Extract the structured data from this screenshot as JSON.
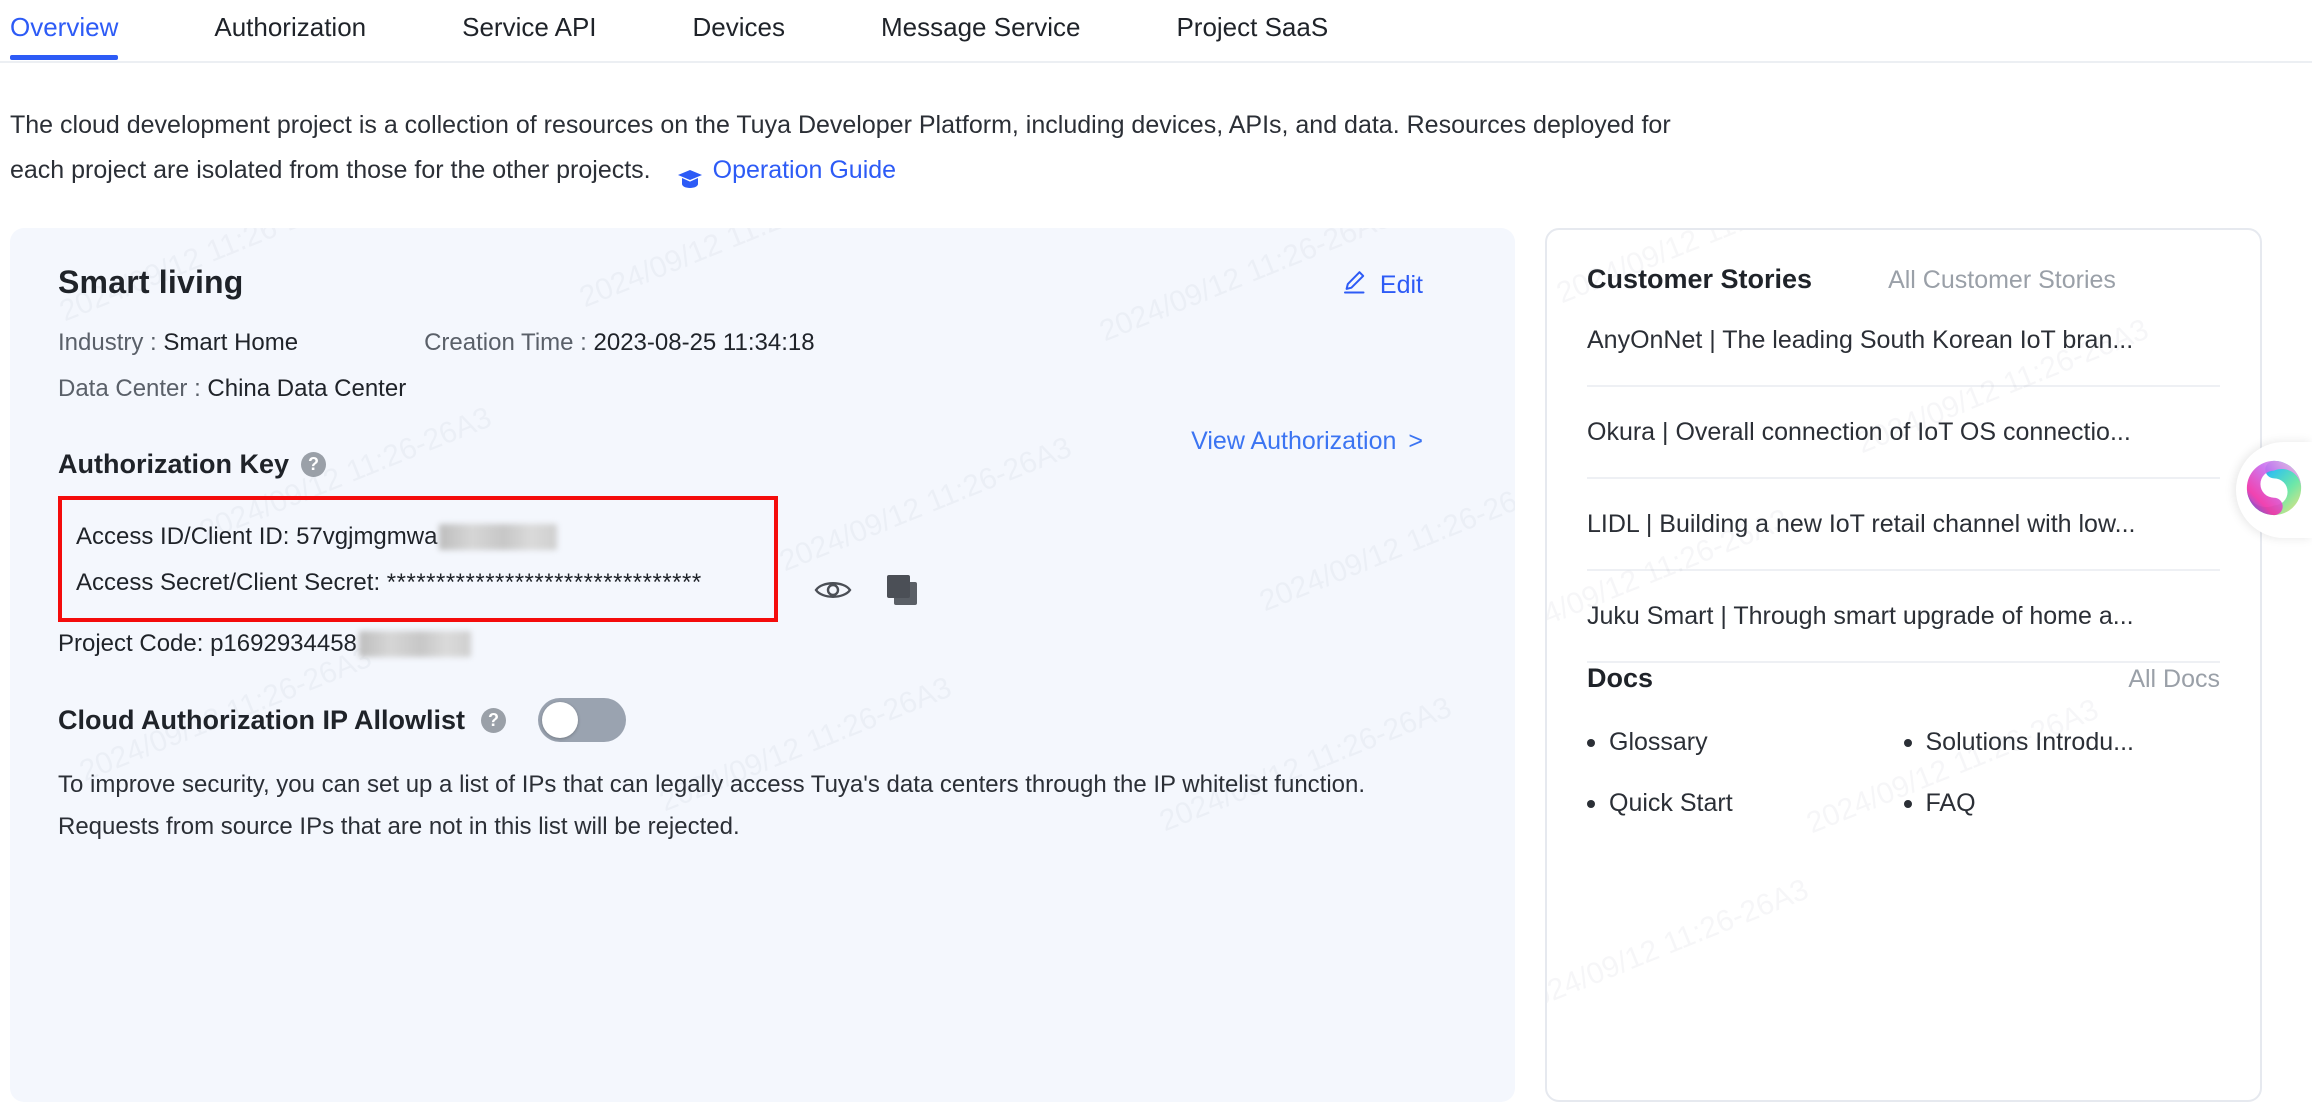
{
  "tabs": [
    {
      "label": "Overview",
      "active": true
    },
    {
      "label": "Authorization",
      "active": false
    },
    {
      "label": "Service API",
      "active": false
    },
    {
      "label": "Devices",
      "active": false
    },
    {
      "label": "Message Service",
      "active": false
    },
    {
      "label": "Project SaaS",
      "active": false
    }
  ],
  "intro": {
    "line1": "The cloud development project is a collection of resources on the Tuya Developer Platform, including devices, APIs, and data. Resources deployed for",
    "line2": "each project are isolated from those for the other projects.",
    "guide_link": "Operation Guide",
    "guide_icon": "graduation-cap-icon"
  },
  "project": {
    "title": "Smart living",
    "edit_label": "Edit",
    "edit_icon": "pencil-icon",
    "industry_label": "Industry :",
    "industry_value": "Smart Home",
    "creation_label": "Creation Time :",
    "creation_value": "2023-08-25 11:34:18",
    "datacenter_label": "Data Center :",
    "datacenter_value": "China Data Center",
    "auth_key_title": "Authorization Key",
    "help_icon": "question-mark-icon",
    "view_auth_label": "View Authorization",
    "view_auth_chevron": ">",
    "access_id_label": "Access ID/Client ID:",
    "access_id_value": "57vgjmgmwa",
    "access_secret_label": "Access Secret/Client Secret:",
    "access_secret_value": "********************************",
    "project_code_label": "Project Code:",
    "project_code_value": "p1692934458",
    "eye_icon": "eye-icon",
    "copy_icon": "copy-icon",
    "allowlist_label": "Cloud Authorization IP Allowlist",
    "allowlist_enabled": false,
    "allowlist_desc_line1": "To improve security, you can set up a list of IPs that can legally access Tuya's data centers through the IP whitelist function.",
    "allowlist_desc_line2": "Requests from source IPs that are not in this list will be rejected.",
    "highlight_color": "#f40c0c",
    "accent_color": "#2d5bf6",
    "card_bg": "#f4f7fd"
  },
  "sidebar": {
    "customer_stories": {
      "title": "Customer Stories",
      "more_label": "All Customer Stories",
      "items": [
        "AnyOnNet | The leading South Korean IoT bran...",
        "Okura | Overall connection of IoT OS connectio...",
        "LIDL | Building a new IoT retail channel with low...",
        "Juku Smart | Through smart upgrade of home a..."
      ]
    },
    "docs": {
      "title": "Docs",
      "more_label": "All Docs",
      "items": [
        "Glossary",
        "Solutions Introdu...",
        "Quick Start",
        "FAQ"
      ]
    }
  },
  "ai_widget": {
    "icon": "ai-swirl-icon"
  }
}
